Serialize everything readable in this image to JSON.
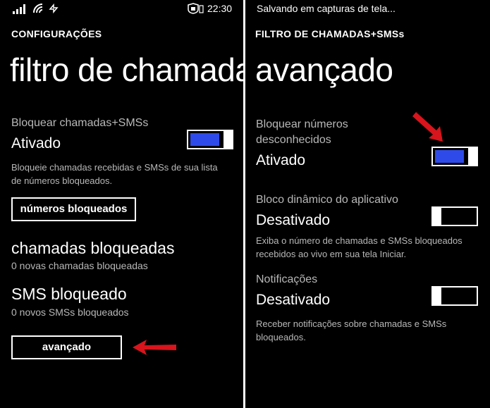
{
  "colors": {
    "accent": "#2e4bea",
    "arrow": "#d8141c",
    "background": "#000000"
  },
  "left": {
    "status_bar": {
      "time": "22:30",
      "icons": [
        "signal-icon",
        "wifi-icon",
        "data-icon",
        "battery-saver-icon"
      ]
    },
    "header": "CONFIGURAÇÕES",
    "title": "filtro de chamadas",
    "block_setting": {
      "label": "Bloquear chamadas+SMSs",
      "value": "Ativado",
      "state": "on",
      "description": "Bloqueie chamadas recebidas e SMSs de sua lista de números bloqueados."
    },
    "blocked_numbers_button": "números bloqueados",
    "calls": {
      "heading": "chamadas bloqueadas",
      "count_text": "0 novas chamadas bloqueadas"
    },
    "sms": {
      "heading": "SMS bloqueado",
      "count_text": "0 novos SMSs bloqueados"
    },
    "advanced_button": "avançado"
  },
  "right": {
    "notification": "Salvando em capturas de tela...",
    "header": "FILTRO DE CHAMADAS+SMSs",
    "title": "avançado",
    "unknown_numbers": {
      "label_line1": "Bloquear números",
      "label_line2": "desconhecidos",
      "value": "Ativado",
      "state": "on"
    },
    "live_tile": {
      "label": "Bloco dinâmico do aplicativo",
      "value": "Desativado",
      "state": "off",
      "description": "Exiba o número de chamadas e SMSs bloqueados recebidos ao vivo em sua tela Iniciar."
    },
    "notifications": {
      "label": "Notificações",
      "value": "Desativado",
      "state": "off",
      "description": "Receber notificações sobre chamadas e SMSs bloqueados."
    }
  }
}
